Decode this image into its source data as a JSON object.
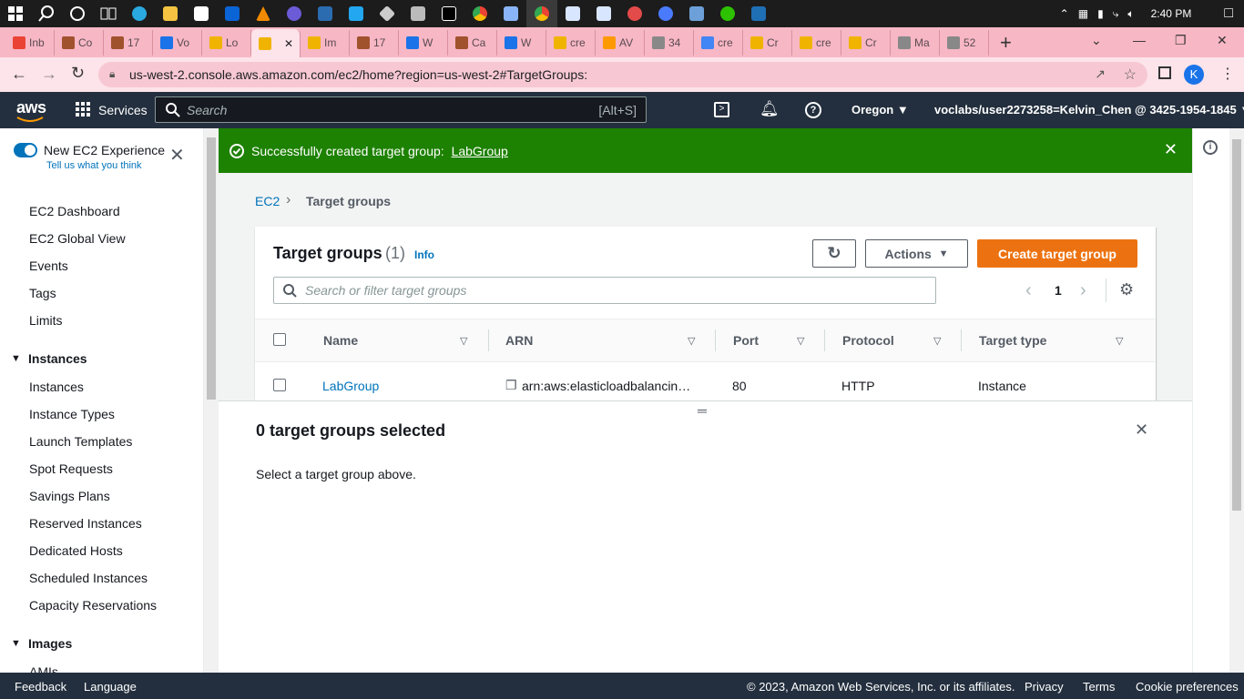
{
  "taskbar": {
    "icons": [
      "windows-start",
      "search",
      "cortana",
      "task-view",
      "edge",
      "file-explorer",
      "store",
      "mail",
      "vlc",
      "app",
      "vscode",
      "git",
      "app",
      "pycharm",
      "chrome",
      "notes",
      "chrome-alt",
      "virtualbox",
      "virtualbox",
      "app",
      "chat",
      "app",
      "wechat",
      "photos"
    ],
    "time": "2:40 PM"
  },
  "tabs": [
    {
      "label": "Inb",
      "color": "#ea4335"
    },
    {
      "label": "Co",
      "color": "#a0522d"
    },
    {
      "label": "17",
      "color": "#a0522d"
    },
    {
      "label": "Vo",
      "color": "#1a73e8"
    },
    {
      "label": "Lo",
      "color": "#f0b400"
    },
    {
      "label": "",
      "color": "#f0b400",
      "active": true
    },
    {
      "label": "Im",
      "color": "#f0b400"
    },
    {
      "label": "17",
      "color": "#a0522d"
    },
    {
      "label": "W",
      "color": "#1a73e8"
    },
    {
      "label": "Ca",
      "color": "#a0522d"
    },
    {
      "label": "W",
      "color": "#1a73e8"
    },
    {
      "label": "cre",
      "color": "#f0b400"
    },
    {
      "label": "AV",
      "color": "#ff9900"
    },
    {
      "label": "34",
      "color": "#888888"
    },
    {
      "label": "cre",
      "color": "#4285f4"
    },
    {
      "label": "Cr",
      "color": "#f0b400"
    },
    {
      "label": "cre",
      "color": "#f0b400"
    },
    {
      "label": "Cr",
      "color": "#f0b400"
    },
    {
      "label": "Ma",
      "color": "#888888"
    },
    {
      "label": "52",
      "color": "#888888"
    }
  ],
  "browser": {
    "url": "us-west-2.console.aws.amazon.com/ec2/home?region=us-west-2#TargetGroups:",
    "profile_initial": "K"
  },
  "aws_header": {
    "logo": "aws",
    "services": "Services",
    "search_placeholder": "Search",
    "search_shortcut": "[Alt+S]",
    "region": "Oregon",
    "account": "voclabs/user2273258=Kelvin_Chen @ 3425-1954-1845"
  },
  "sidebar": {
    "toggle_label": "New EC2 Experience",
    "toggle_sub": "Tell us what you think",
    "items": [
      "EC2 Dashboard",
      "EC2 Global View",
      "Events",
      "Tags",
      "Limits"
    ],
    "instances_header": "Instances",
    "instances_items": [
      "Instances",
      "Instance Types",
      "Launch Templates",
      "Spot Requests",
      "Savings Plans",
      "Reserved Instances",
      "Dedicated Hosts",
      "Scheduled Instances",
      "Capacity Reservations"
    ],
    "images_header": "Images",
    "images_items": [
      "AMIs"
    ]
  },
  "flash": {
    "message": "Successfully created target group: ",
    "link": "LabGroup"
  },
  "breadcrumb": {
    "root": "EC2",
    "current": "Target groups"
  },
  "panel": {
    "title": "Target groups",
    "count": "(1)",
    "info": "Info",
    "actions": "Actions",
    "create": "Create target group",
    "filter_placeholder": "Search or filter target groups",
    "page": "1"
  },
  "table": {
    "headers": [
      "Name",
      "ARN",
      "Port",
      "Protocol",
      "Target type"
    ],
    "rows": [
      {
        "name": "LabGroup",
        "arn": "arn:aws:elasticloadbalancin…",
        "port": "80",
        "protocol": "HTTP",
        "type": "Instance"
      }
    ]
  },
  "split": {
    "title": "0 target groups selected",
    "body": "Select a target group above."
  },
  "footer": {
    "feedback": "Feedback",
    "language": "Language",
    "copyright": "© 2023, Amazon Web Services, Inc. or its affiliates.",
    "privacy": "Privacy",
    "terms": "Terms",
    "cookies": "Cookie preferences"
  },
  "colors": {
    "aws_nav": "#232f3e",
    "success": "#1d8102",
    "primary_button": "#ec7211",
    "link": "#0073bb",
    "tab_strip": "#f7b7c5"
  }
}
